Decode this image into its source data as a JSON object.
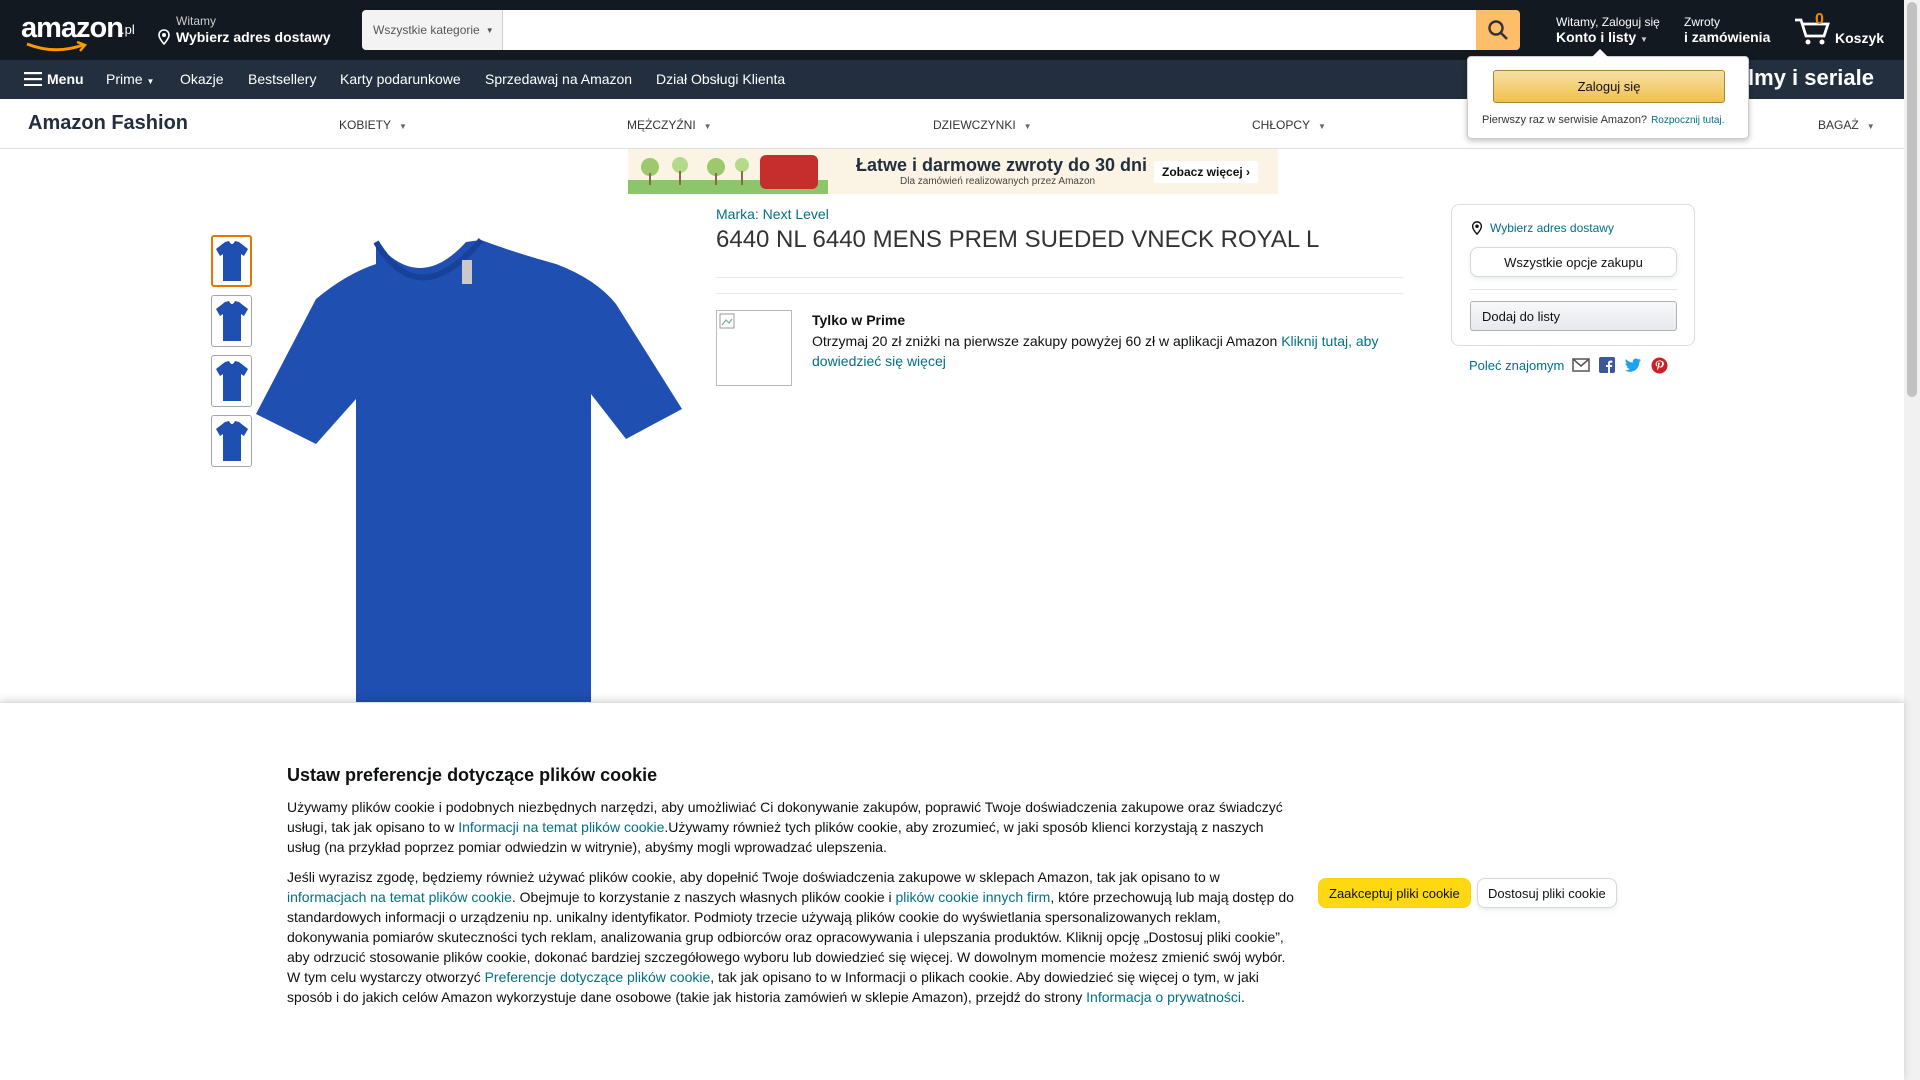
{
  "header": {
    "logo_text": "amazon",
    "logo_tld": ".pl",
    "deliver_line1": "Witamy",
    "deliver_line2": "Wybierz adres dostawy",
    "search_category": "Wszystkie kategorie",
    "search_placeholder": "",
    "account_line1": "Witamy, Zaloguj się",
    "account_line2": "Konto i listy",
    "orders_line1": "Zwroty",
    "orders_line2": "i zamówienia",
    "cart_count": "0",
    "cart_label": "Koszyk"
  },
  "nav": {
    "menu": "Menu",
    "items": [
      "Prime",
      "Okazje",
      "Bestsellery",
      "Karty podarunkowe",
      "Sprzedawaj na Amazon",
      "Dział Obsługi Klienta"
    ],
    "promo": "filmy i seriale"
  },
  "fashion": {
    "brand": "Amazon Fashion",
    "categories": [
      "KOBIETY",
      "MĘŻCZYŹNI",
      "DZIEWCZYNKI",
      "CHŁOPCY",
      "BAGAŻ"
    ]
  },
  "banner": {
    "title": "Łatwe i darmowe zwroty do 30 dni",
    "subtitle": "Dla zamówień realizowanych przez Amazon",
    "cta": "Zobacz więcej ›"
  },
  "product": {
    "brand_link": "Marka: Next Level",
    "title": "6440 NL 6440 MENS PREM SUEDED VNECK ROYAL L",
    "prime_title": "Tylko w Prime",
    "prime_text": "Otrzymaj 20 zł zniżki na pierwsze zakupy powyżej 60 zł w aplikacji Amazon ",
    "prime_link": "Kliknij tutaj, aby dowiedzieć się więcej",
    "shirt_color": "#1f4fb0"
  },
  "buybox": {
    "address": "Wybierz adres dostawy",
    "all_options": "Wszystkie opcje zakupu",
    "add_to_list": "Dodaj do listy",
    "share": "Poleć znajomym"
  },
  "popover": {
    "signin": "Zaloguj się",
    "new_customer": "Pierwszy raz w serwisie Amazon?",
    "start_here": "Rozpocznij tutaj."
  },
  "cookie": {
    "title": "Ustaw preferencje dotyczące plików cookie",
    "p1_a": "Używamy plików cookie i podobnych niezbędnych narzędzi, aby umożliwiać Ci dokonywanie zakupów, poprawić Twoje doświadczenia zakupowe oraz świadczyć usługi, tak jak opisano to w ",
    "p1_link": "Informacji na temat plików cookie",
    "p1_b": ".Używamy również tych plików cookie, aby zrozumieć, w jaki sposób klienci korzystają z naszych usług (na przykład poprzez pomiar odwiedzin w witrynie), abyśmy mogli wprowadzać ulepszenia.",
    "p2_a": "Jeśli wyrazisz zgodę, będziemy również używać plików cookie, aby dopełnić Twoje doświadczenia zakupowe w sklepach Amazon, tak jak opisano to w ",
    "p2_link1": "informacjach na temat plików cookie",
    "p2_b": ". Obejmuje to korzystanie z naszych własnych plików cookie i ",
    "p2_link2": "plików cookie innych firm",
    "p2_c": ", które przechowują lub mają dostęp do standardowych informacji o urządzeniu np. unikalny identyfikator. Podmioty trzecie używają plików cookie do wyświetlania spersonalizowanych reklam, dokonywania pomiarów skuteczności tych reklam, analizowania grup odbiorców oraz opracowywania i ulepszania produktów. Kliknij opcję „Dostosuj pliki cookie”, aby odrzucić stosowanie plików cookie, dokonać bardziej szczegółowego wyboru lub dowiedzieć się więcej. W dowolnym momencie możesz zmienić swój wybór. W tym celu wystarczy otworzyć ",
    "p2_link3": "Preferencje dotyczące plików cookie",
    "p2_d": ", tak jak opisano to w Informacji o plikach cookie. Aby dowiedzieć się więcej o tym, w jaki sposób i do jakich celów Amazon wykorzystuje dane osobowe (takie jak historia zamówień w sklepie Amazon), przejdź do strony ",
    "p2_link4": "Informacja o prywatności",
    "p2_e": ".",
    "accept": "Zaakceptuj pliki cookie",
    "customize": "Dostosuj pliki cookie"
  }
}
